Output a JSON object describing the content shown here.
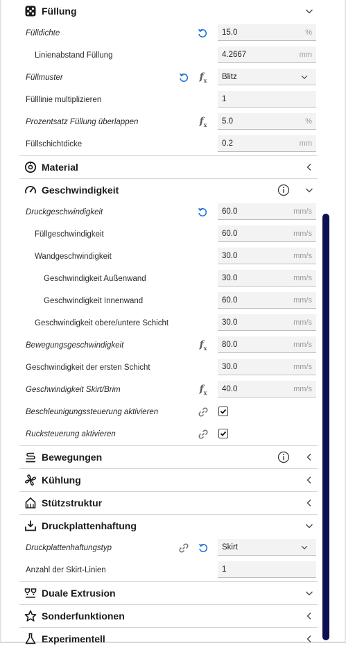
{
  "colors": {
    "accent": "#1e73d8",
    "scrollbar": "#0d1050",
    "field_bg": "#f3f3f3"
  },
  "sections": {
    "infill": {
      "title": "Füllung",
      "icon": "dice-icon",
      "expanded": true
    },
    "material": {
      "title": "Material",
      "icon": "spool-icon",
      "expanded": false
    },
    "speed": {
      "title": "Geschwindigkeit",
      "icon": "speedometer-icon",
      "expanded": true
    },
    "travel": {
      "title": "Bewegungen",
      "icon": "travel-icon",
      "expanded": false
    },
    "cooling": {
      "title": "Kühlung",
      "icon": "fan-icon",
      "expanded": false
    },
    "support": {
      "title": "Stützstruktur",
      "icon": "support-icon",
      "expanded": false
    },
    "adhesion": {
      "title": "Druckplattenhaftung",
      "icon": "adhesion-icon",
      "expanded": true
    },
    "dual": {
      "title": "Duale Extrusion",
      "icon": "dual-extrusion-icon",
      "expanded": true
    },
    "special": {
      "title": "Sonderfunktionen",
      "icon": "star-icon",
      "expanded": false
    },
    "experimental": {
      "title": "Experimentell",
      "icon": "flask-icon",
      "expanded": false
    }
  },
  "infill": {
    "density": {
      "label": "Fülldichte",
      "value": "15.0",
      "unit": "%"
    },
    "line_distance": {
      "label": "Linienabstand Füllung",
      "value": "4.2667",
      "unit": "mm"
    },
    "pattern": {
      "label": "Füllmuster",
      "value": "Blitz"
    },
    "line_multiplier": {
      "label": "Fülllinie multiplizieren",
      "value": "1"
    },
    "overlap": {
      "label": "Prozentsatz Füllung überlappen",
      "value": "5.0",
      "unit": "%"
    },
    "layer_thickness": {
      "label": "Füllschichtdicke",
      "value": "0.2",
      "unit": "mm"
    }
  },
  "speed": {
    "print_speed": {
      "label": "Druckgeschwindigkeit",
      "value": "60.0",
      "unit": "mm/s"
    },
    "infill_speed": {
      "label": "Füllgeschwindigkeit",
      "value": "60.0",
      "unit": "mm/s"
    },
    "wall_speed": {
      "label": "Wandgeschwindigkeit",
      "value": "30.0",
      "unit": "mm/s"
    },
    "outer_wall": {
      "label": "Geschwindigkeit Außenwand",
      "value": "30.0",
      "unit": "mm/s"
    },
    "inner_wall": {
      "label": "Geschwindigkeit Innenwand",
      "value": "60.0",
      "unit": "mm/s"
    },
    "top_bottom": {
      "label": "Geschwindigkeit obere/untere Schicht",
      "value": "30.0",
      "unit": "mm/s"
    },
    "travel_speed": {
      "label": "Bewegungsgeschwindigkeit",
      "value": "80.0",
      "unit": "mm/s"
    },
    "first_layer": {
      "label": "Geschwindigkeit der ersten Schicht",
      "value": "30.0",
      "unit": "mm/s"
    },
    "skirt_brim": {
      "label": "Geschwindigkeit Skirt/Brim",
      "value": "40.0",
      "unit": "mm/s"
    },
    "accel_control": {
      "label": "Beschleunigungssteuerung aktivieren",
      "checked": true
    },
    "jerk_control": {
      "label": "Rucksteuerung aktivieren",
      "checked": true
    }
  },
  "adhesion": {
    "type": {
      "label": "Druckplattenhaftungstyp",
      "value": "Skirt"
    },
    "skirt_lines": {
      "label": "Anzahl der Skirt-Linien",
      "value": "1"
    }
  }
}
